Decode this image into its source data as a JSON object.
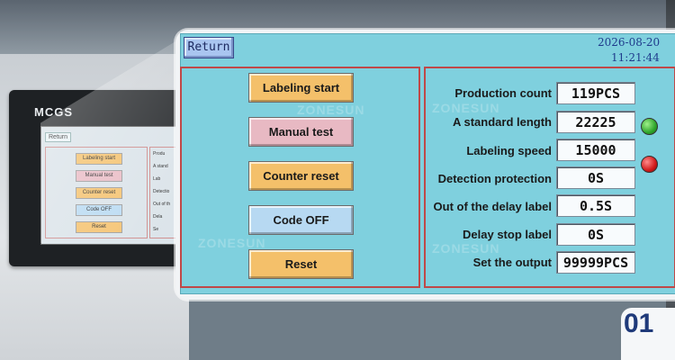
{
  "device": {
    "logo": "MCGS",
    "mini_screen": {
      "return_label": "Return",
      "buttons": [
        "Labeling start",
        "Manual test",
        "Counter reset",
        "Code OFF",
        "Reset"
      ],
      "labels": [
        "Produ",
        "A stand",
        "Lab",
        "Detectio",
        "Out of th",
        "Dela",
        "Se"
      ]
    }
  },
  "header": {
    "return_label": "Return",
    "date": "2026-08-20",
    "time": "11:21:44"
  },
  "controls": {
    "labeling_start": "Labeling start",
    "manual_test": "Manual test",
    "counter_reset": "Counter reset",
    "code_off": "Code OFF",
    "reset": "Reset"
  },
  "params": [
    {
      "label": "Production count",
      "value": "119PCS"
    },
    {
      "label": "A standard length",
      "value": "22225"
    },
    {
      "label": "Labeling speed",
      "value": "15000"
    },
    {
      "label": "Detection protection",
      "value": "0S"
    },
    {
      "label": "Out of the delay label",
      "value": "0.5S"
    },
    {
      "label": "Delay stop label",
      "value": "0S"
    },
    {
      "label": "Set the output",
      "value": "99999PCS"
    }
  ],
  "indicators": {
    "green_color": "#2fa52b",
    "red_color": "#d11a1a"
  },
  "watermark": "ZONESUN",
  "badge": "01",
  "colors": {
    "screen_bg": "#7fd0de",
    "frame_border": "#c04848",
    "amber_button": "#f4c06a",
    "pink_button": "#e8b9c3",
    "blue_button": "#b7d9f2",
    "clock_text": "#1f3b8c",
    "badge_text": "#1f3a7a"
  }
}
